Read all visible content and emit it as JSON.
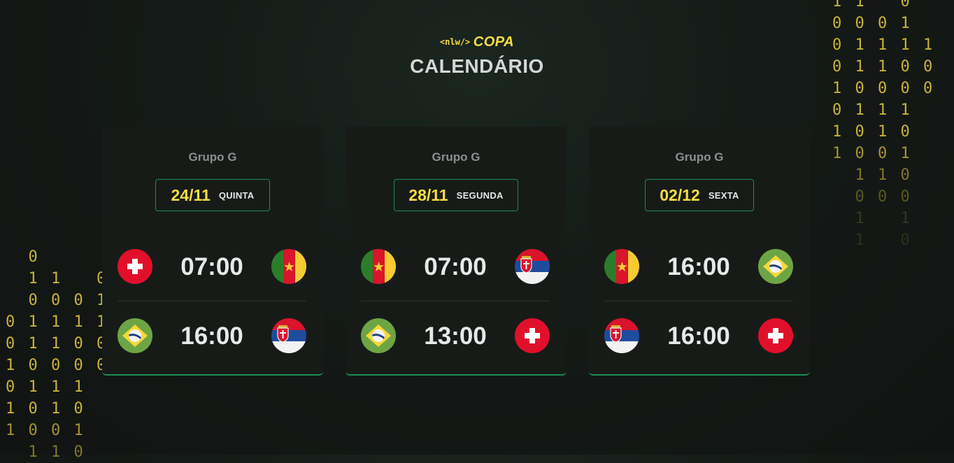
{
  "brand": {
    "tag": "<nlw/>",
    "name": "COPA"
  },
  "page_title": "CALENDÁRIO",
  "binary_right": [
    "1 1   0",
    "0 0 0 1",
    "0 1 1 1 1",
    "0 1 1 0 0",
    "1 0 0 0 0",
    "0 1 1 1",
    "1 0 1 0",
    "1 0 0 1",
    "  1 1 0",
    "  0 0 0",
    "  1   1",
    "  1   0"
  ],
  "binary_left": [
    "  0",
    "  1 1   0",
    "  0 0 0 1",
    "0 1 1 1 1",
    "0 1 1 0 0",
    "1 0 0 0 0",
    "0 1 1 1",
    "1 0 1 0",
    "1 0 0 1",
    "  1 1 0"
  ],
  "cards": [
    {
      "group": "Grupo G",
      "date": "24/11",
      "weekday": "QUINTA",
      "matches": [
        {
          "home": "switzerland",
          "time": "07:00",
          "away": "cameroon"
        },
        {
          "home": "brazil",
          "time": "16:00",
          "away": "serbia"
        }
      ]
    },
    {
      "group": "Grupo G",
      "date": "28/11",
      "weekday": "SEGUNDA",
      "matches": [
        {
          "home": "cameroon",
          "time": "07:00",
          "away": "serbia"
        },
        {
          "home": "brazil",
          "time": "13:00",
          "away": "switzerland"
        }
      ]
    },
    {
      "group": "Grupo G",
      "date": "02/12",
      "weekday": "SEXTA",
      "matches": [
        {
          "home": "cameroon",
          "time": "16:00",
          "away": "brazil"
        },
        {
          "home": "serbia",
          "time": "16:00",
          "away": "switzerland"
        }
      ]
    }
  ],
  "colors": {
    "accent": "#f7dd43",
    "border": "#1f8a52",
    "card": "#171b18"
  }
}
